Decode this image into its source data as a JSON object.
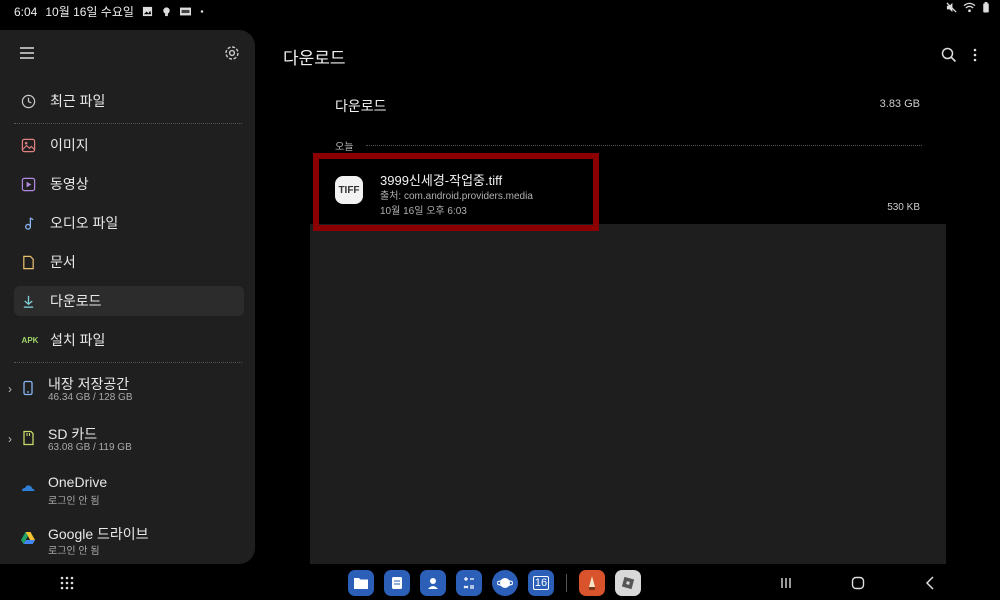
{
  "status_bar": {
    "time": "6:04",
    "date": "10월 16일 수요일",
    "icons": [
      "gallery-icon",
      "bulb-icon",
      "card-icon",
      "dot-icon",
      "mute-icon",
      "wifi-icon",
      "battery-icon"
    ]
  },
  "sidebar": {
    "items": [
      {
        "label": "최근 파일",
        "icon": "clock-icon"
      },
      {
        "label": "이미지",
        "icon": "image-icon"
      },
      {
        "label": "동영상",
        "icon": "video-icon"
      },
      {
        "label": "오디오 파일",
        "icon": "music-icon"
      },
      {
        "label": "문서",
        "icon": "document-icon"
      },
      {
        "label": "다운로드",
        "icon": "download-icon",
        "active": true
      },
      {
        "label": "설치 파일",
        "icon": "apk-icon",
        "badge": "APK"
      }
    ],
    "storage": [
      {
        "name": "내장 저장공간",
        "sub": "46.34 GB / 128 GB",
        "icon": "phone-icon"
      },
      {
        "name": "SD 카드",
        "sub": "63.08 GB / 119 GB",
        "icon": "sd-card-icon"
      },
      {
        "name": "OneDrive",
        "sub": "로그인 안 됨",
        "icon": "onedrive-icon"
      },
      {
        "name": "Google 드라이브",
        "sub": "로그인 안 됨",
        "icon": "google-drive-icon"
      }
    ]
  },
  "main": {
    "title": "다운로드",
    "folder_name": "다운로드",
    "folder_size": "3.83 GB",
    "group_label": "오늘",
    "file": {
      "icon_text": "TIFF",
      "name": "3999신세경-작업중.tiff",
      "source": "출처: com.android.providers.media",
      "date": "10월 16일 오후 6:03",
      "size": "530 KB"
    }
  },
  "taskbar": {
    "dock_apps": [
      "my-files-icon",
      "notes-icon",
      "contacts-icon",
      "calculator-icon",
      "internet-icon",
      "calendar-icon",
      "sketch-app-icon",
      "roblox-icon"
    ],
    "calendar_day": "16"
  },
  "colors": {
    "background": "#000000",
    "sidebar": "#1f1f1f",
    "highlight_border": "#8b0000",
    "file_panel": "#1e1e1e"
  }
}
